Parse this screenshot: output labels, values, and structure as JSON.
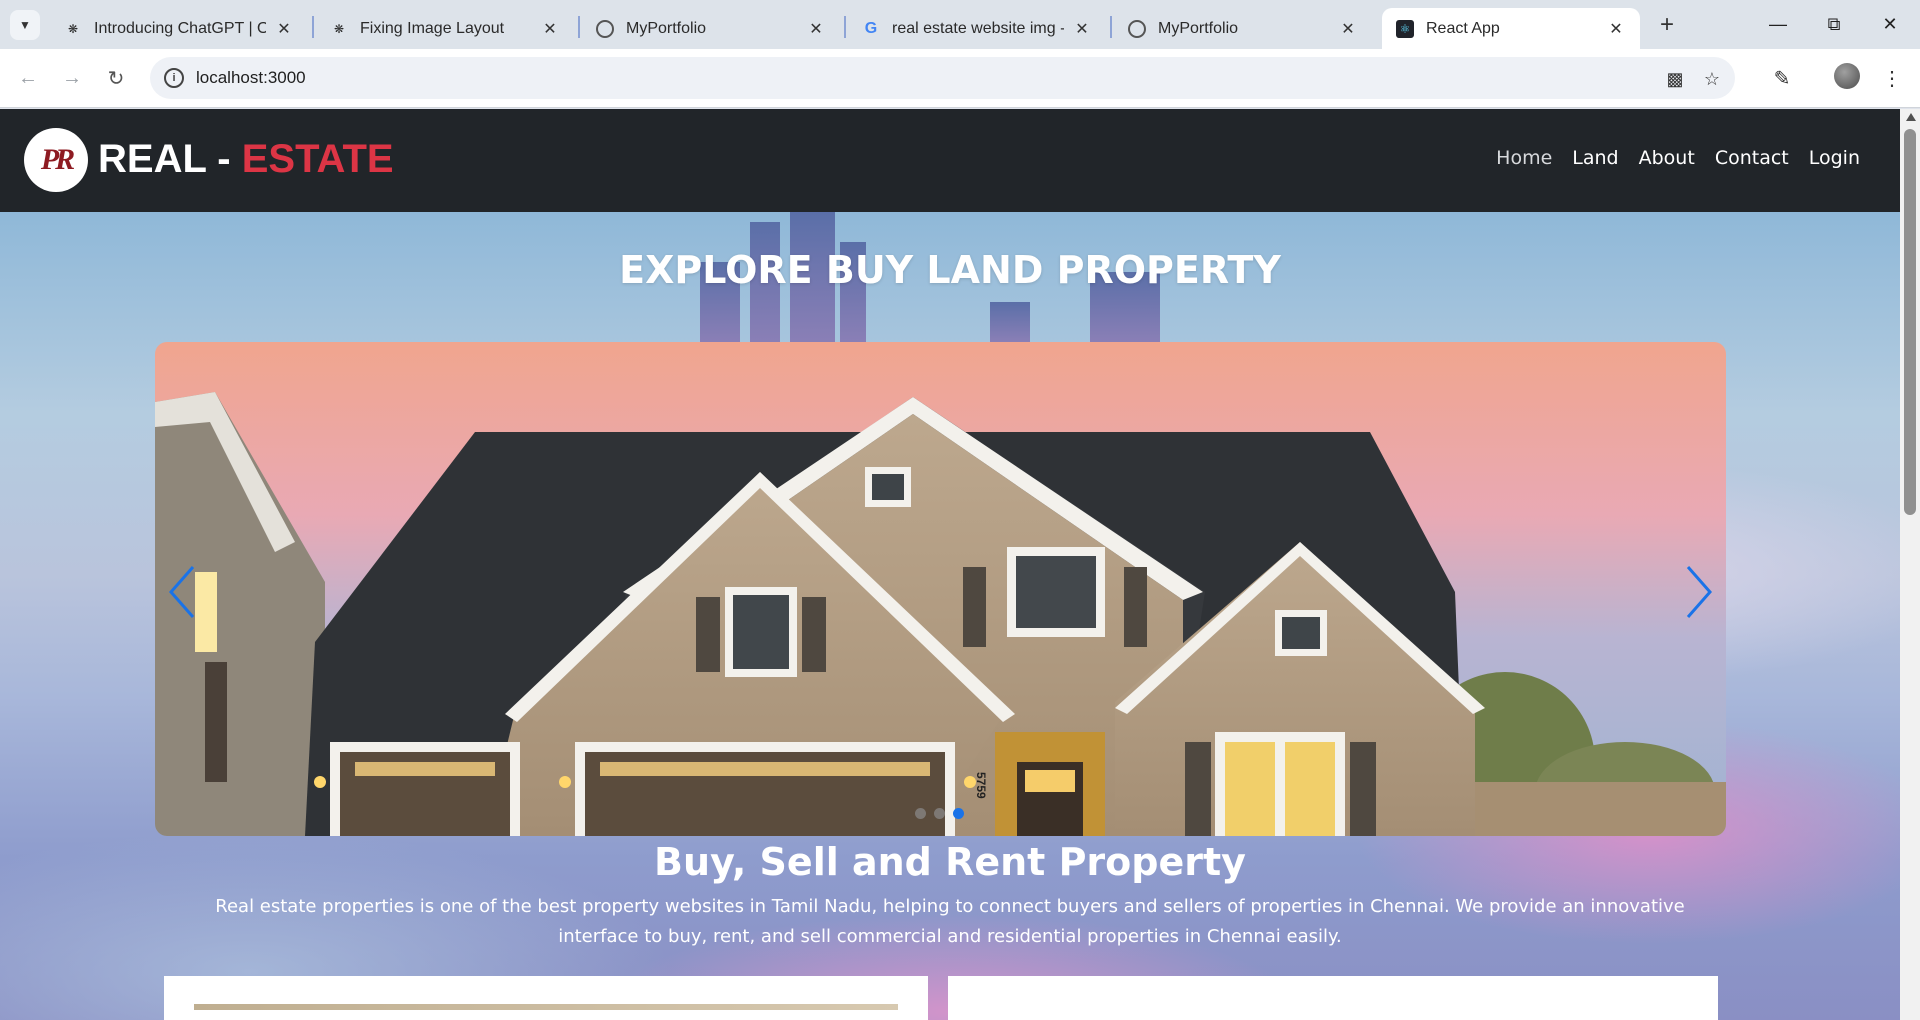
{
  "browser": {
    "tabs": [
      {
        "title": "Introducing ChatGPT | Ope",
        "icon": "openai-icon"
      },
      {
        "title": "Fixing Image Layout",
        "icon": "openai-icon"
      },
      {
        "title": "MyPortfolio",
        "icon": "globe-icon"
      },
      {
        "title": "real estate website img - G",
        "icon": "google-icon"
      },
      {
        "title": "MyPortfolio",
        "icon": "globe-icon"
      },
      {
        "title": "React App",
        "icon": "react-icon",
        "active": true
      }
    ],
    "url": "localhost:3000"
  },
  "navbar": {
    "logo_text": "PR",
    "brand_left": "REAL - ",
    "brand_right": "ESTATE",
    "links": [
      "Home",
      "Land",
      "About",
      "Contact",
      "Login"
    ],
    "active_link": "Home"
  },
  "hero": {
    "title": "EXPLORE BUY LAND PROPERTY",
    "house_number": "5759",
    "carousel": {
      "slide_count": 3,
      "active_index": 2
    }
  },
  "section": {
    "title": "Buy, Sell and Rent Property",
    "description": "Real estate properties is one of the best property websites in Tamil Nadu, helping to connect buyers and sellers of properties in Chennai. We provide an innovative interface to buy, rent, and sell commercial and residential properties in Chennai easily."
  },
  "colors": {
    "navbar_bg": "#212529",
    "brand_accent": "#dc3545",
    "carousel_control": "#1a73e8"
  }
}
